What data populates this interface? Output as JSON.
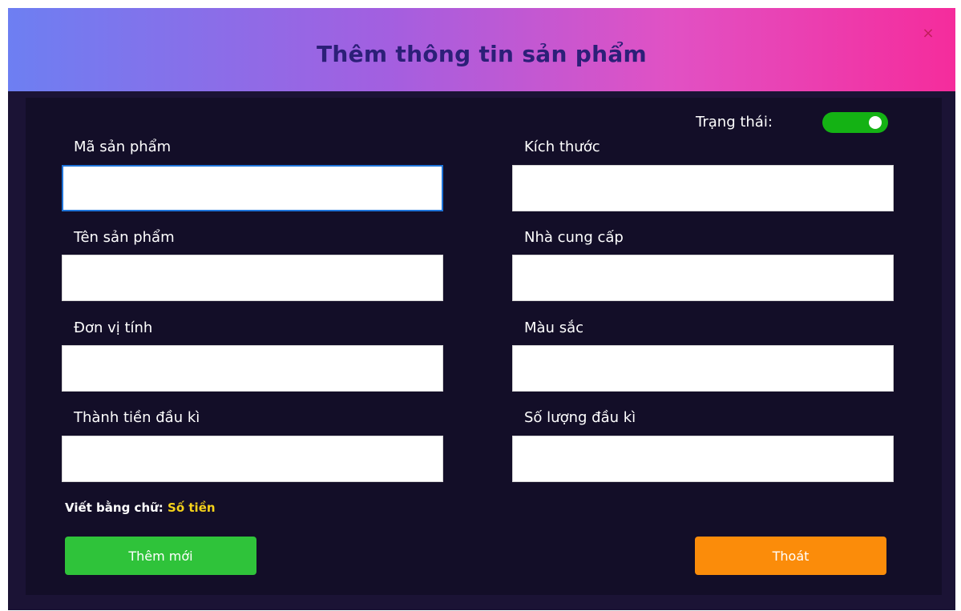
{
  "dialog": {
    "title": "Thêm thông tin sản phẩm",
    "close_glyph": "×"
  },
  "status": {
    "label": "Trạng thái:",
    "enabled": true
  },
  "fields": {
    "product_code": {
      "label": "Mã sản phẩm",
      "value": ""
    },
    "size": {
      "label": "Kích thước",
      "value": ""
    },
    "product_name": {
      "label": "Tên sản phẩm",
      "value": ""
    },
    "supplier": {
      "label": "Nhà cung cấp",
      "value": ""
    },
    "unit": {
      "label": "Đơn vị tính",
      "value": ""
    },
    "color": {
      "label": "Màu sắc",
      "value": ""
    },
    "opening_amount": {
      "label": "Thành tiền đầu kì",
      "value": ""
    },
    "opening_quantity": {
      "label": "Số lượng đầu kì",
      "value": ""
    }
  },
  "amount_in_words": {
    "label": "Viết bằng chữ:",
    "value": "Số tiền"
  },
  "buttons": {
    "add": "Thêm mới",
    "exit": "Thoát"
  },
  "colors": {
    "header_gradient_start": "#6d7ff2",
    "header_gradient_end": "#f52c9c",
    "panel_bg": "#130e28",
    "toggle_on": "#14b214",
    "add_button": "#2fc33a",
    "exit_button": "#fb8c0a",
    "words_value": "#f5d21a"
  },
  "icons": {
    "close": "close-icon"
  }
}
